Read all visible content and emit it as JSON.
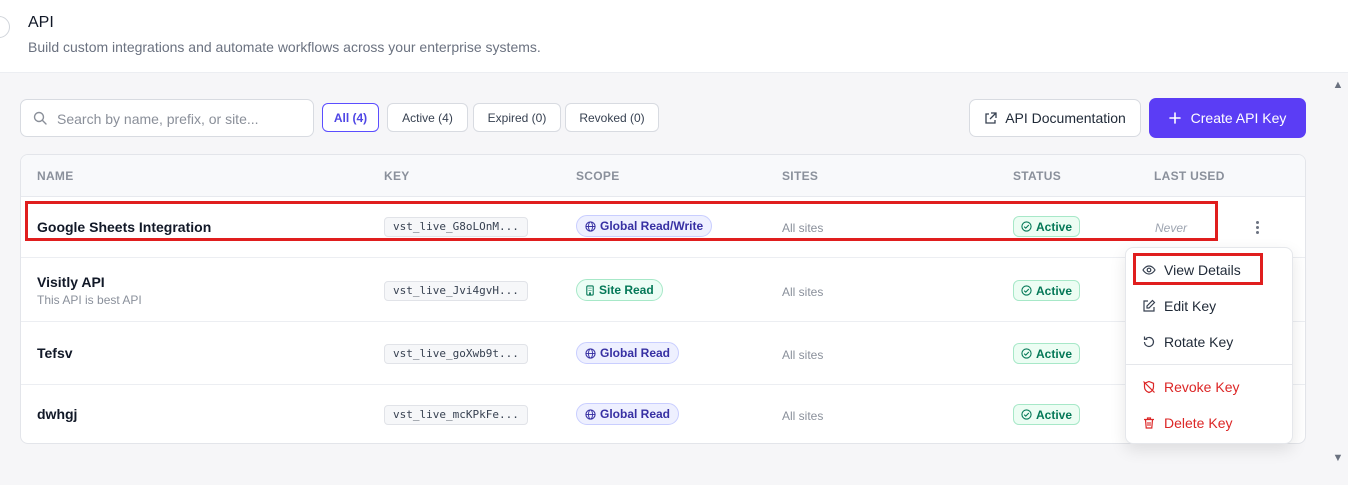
{
  "header": {
    "title": "API",
    "subtitle": "Build custom integrations and automate workflows across your enterprise systems."
  },
  "toolbar": {
    "search_placeholder": "Search by name, prefix, or site...",
    "filters": [
      {
        "label": "All (4)",
        "active": true
      },
      {
        "label": "Active (4)",
        "active": false
      },
      {
        "label": "Expired (0)",
        "active": false
      },
      {
        "label": "Revoked (0)",
        "active": false
      }
    ],
    "docs_label": "API Documentation",
    "create_label": "Create API Key",
    "accent_color": "#5b3df5"
  },
  "table": {
    "columns": [
      "NAME",
      "KEY",
      "SCOPE",
      "SITES",
      "STATUS",
      "LAST USED"
    ],
    "rows": [
      {
        "name": "Google Sheets Integration",
        "description": "",
        "key": "vst_live_G8oLOnM...",
        "scope": "Global Read/Write",
        "scope_icon": "globe-icon",
        "sites": "All sites",
        "status": "Active",
        "last_used": "Never"
      },
      {
        "name": "Visitly API",
        "description": "This API is best API",
        "key": "vst_live_Jvi4gvH...",
        "scope": "Site Read",
        "scope_icon": "building-icon",
        "sites": "All sites",
        "status": "Active",
        "last_used": ""
      },
      {
        "name": "Tefsv",
        "description": "",
        "key": "vst_live_goXwb9t...",
        "scope": "Global Read",
        "scope_icon": "globe-icon",
        "sites": "All sites",
        "status": "Active",
        "last_used": ""
      },
      {
        "name": "dwhgj",
        "description": "",
        "key": "vst_live_mcKPkFe...",
        "scope": "Global Read",
        "scope_icon": "globe-icon",
        "sites": "All sites",
        "status": "Active",
        "last_used": ""
      }
    ]
  },
  "menu": {
    "items": [
      {
        "label": "View Details",
        "icon": "eye-icon",
        "danger": false
      },
      {
        "label": "Edit Key",
        "icon": "edit-icon",
        "danger": false
      },
      {
        "label": "Rotate Key",
        "icon": "rotate-icon",
        "danger": false
      },
      {
        "label": "Revoke Key",
        "icon": "revoke-icon",
        "danger": true
      },
      {
        "label": "Delete Key",
        "icon": "trash-icon",
        "danger": true
      }
    ]
  }
}
